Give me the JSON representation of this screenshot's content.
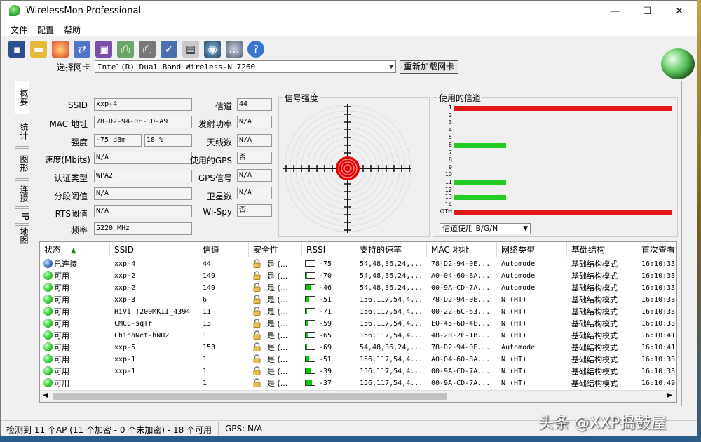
{
  "window": {
    "title": "WirelessMon Professional",
    "minimize": "—",
    "maximize": "☐",
    "close": "✕"
  },
  "menu": [
    "文件",
    "配置",
    "帮助"
  ],
  "toolbar_icons": [
    "save-icon",
    "open-folder-icon",
    "record-icon",
    "network-icon",
    "computers-icon",
    "print-icon",
    "printer-icon",
    "check-icon",
    "clipboard-icon",
    "globe-network-icon",
    "chat-icon",
    "help-icon"
  ],
  "adapter": {
    "label": "选择网卡",
    "value": "Intel(R) Dual Band Wireless-N 7260",
    "reload": "重新加载网卡"
  },
  "tabs": [
    "概要",
    "统计",
    "图形",
    "连接",
    "IP",
    "地图"
  ],
  "summary": {
    "ssid_label": "SSID",
    "ssid": "xxp-4",
    "mac_label": "MAC 地址",
    "mac": "78-D2-94-0E-1D-A9",
    "strength_label": "强度",
    "strength_dbm": "-75 dBm",
    "strength_pct": "18 %",
    "speed_label": "速度(Mbits)",
    "speed": "N/A",
    "auth_label": "认证类型",
    "auth": "WPA2",
    "frag_label": "分段阈值",
    "frag": "N/A",
    "rts_label": "RTS阈值",
    "rts": "N/A",
    "freq_label": "频率",
    "freq": "5220 MHz",
    "channel_label": "信道",
    "channel": "44",
    "txpower_label": "发射功率",
    "txpower": "N/A",
    "antenna_label": "天线数",
    "antenna": "N/A",
    "gps_used_label": "使用的GPS",
    "gps_used": "否",
    "gps_signal_label": "GPS信号",
    "gps_signal": "N/A",
    "satellites_label": "卫星数",
    "satellites": "N/A",
    "wispy_label": "Wi-Spy",
    "wispy": "否"
  },
  "signal_panel": {
    "title": "信号强度"
  },
  "channel_panel": {
    "title": "使用的信道",
    "select": "信道使用 B/G/N",
    "colors": {
      "high": "#e01818",
      "medium": "#22cc22"
    },
    "channels": [
      {
        "label": "1",
        "usage": 1.0,
        "level": "high"
      },
      {
        "label": "2",
        "usage": 0,
        "level": "none"
      },
      {
        "label": "3",
        "usage": 0,
        "level": "none"
      },
      {
        "label": "4",
        "usage": 0,
        "level": "none"
      },
      {
        "label": "5",
        "usage": 0,
        "level": "none"
      },
      {
        "label": "6",
        "usage": 0.24,
        "level": "medium"
      },
      {
        "label": "7",
        "usage": 0,
        "level": "none"
      },
      {
        "label": "8",
        "usage": 0,
        "level": "none"
      },
      {
        "label": "9",
        "usage": 0,
        "level": "none"
      },
      {
        "label": "10",
        "usage": 0,
        "level": "none"
      },
      {
        "label": "11",
        "usage": 0.24,
        "level": "medium"
      },
      {
        "label": "12",
        "usage": 0,
        "level": "none"
      },
      {
        "label": "13",
        "usage": 0.24,
        "level": "medium"
      },
      {
        "label": "14",
        "usage": 0,
        "level": "none"
      },
      {
        "label": "OTH",
        "usage": 1.0,
        "level": "high"
      }
    ]
  },
  "table": {
    "columns": [
      "状态",
      "SSID",
      "信道",
      "安全性",
      "RSSI",
      "支持的速率",
      "MAC 地址",
      "网络类型",
      "基础结构",
      "首次查看"
    ],
    "rows": [
      {
        "status": "已连接",
        "connected": true,
        "ssid": "xxp-4",
        "channel": "44",
        "security": "是 (...",
        "rssi": "-75",
        "rssi_level": 0.1,
        "rates": "54,48,36,24,...",
        "mac": "78-D2-94-0E...",
        "nettype": "Automode",
        "infra": "基础结构模式",
        "first": "16:10:33"
      },
      {
        "status": "可用",
        "connected": false,
        "ssid": "xxp-2",
        "channel": "149",
        "security": "是 (...",
        "rssi": "-70",
        "rssi_level": 0.15,
        "rates": "54,48,36,24,...",
        "mac": "A0-04-60-8A...",
        "nettype": "Automode",
        "infra": "基础结构模式",
        "first": "16:10:33"
      },
      {
        "status": "可用",
        "connected": false,
        "ssid": "xxp-2",
        "channel": "149",
        "security": "是 (...",
        "rssi": "-46",
        "rssi_level": 0.5,
        "rates": "54,48,36,24,...",
        "mac": "00-9A-CD-7A...",
        "nettype": "Automode",
        "infra": "基础结构模式",
        "first": "16:10:33"
      },
      {
        "status": "可用",
        "connected": false,
        "ssid": "xxp-3",
        "channel": "6",
        "security": "是 (...",
        "rssi": "-51",
        "rssi_level": 0.4,
        "rates": "156,117,54,4...",
        "mac": "78-D2-94-0E...",
        "nettype": "N (HT)",
        "infra": "基础结构模式",
        "first": "16:10:33"
      },
      {
        "status": "可用",
        "connected": false,
        "ssid": "HiVi T200MKII_4394",
        "channel": "11",
        "security": "是 (...",
        "rssi": "-71",
        "rssi_level": 0.15,
        "rates": "156,117,54,4...",
        "mac": "00-22-6C-63...",
        "nettype": "N (HT)",
        "infra": "基础结构模式",
        "first": "16:10:33"
      },
      {
        "status": "可用",
        "connected": false,
        "ssid": "CMCC-sqTr",
        "channel": "13",
        "security": "是 (...",
        "rssi": "-59",
        "rssi_level": 0.3,
        "rates": "156,117,54,4...",
        "mac": "E0-45-6D-4E...",
        "nettype": "N (HT)",
        "infra": "基础结构模式",
        "first": "16:10:33"
      },
      {
        "status": "可用",
        "connected": false,
        "ssid": "ChinaNet-hNU2",
        "channel": "1",
        "security": "是 (...",
        "rssi": "-65",
        "rssi_level": 0.2,
        "rates": "156,117,54,4...",
        "mac": "48-28-2F-1B...",
        "nettype": "N (HT)",
        "infra": "基础结构模式",
        "first": "16:10:41"
      },
      {
        "status": "可用",
        "connected": false,
        "ssid": "xxp-5",
        "channel": "153",
        "security": "是 (...",
        "rssi": "-69",
        "rssi_level": 0.15,
        "rates": "54,48,36,24,...",
        "mac": "78-D2-94-0E...",
        "nettype": "Automode",
        "infra": "基础结构模式",
        "first": "16:10:41"
      },
      {
        "status": "可用",
        "connected": false,
        "ssid": "xxp-1",
        "channel": "1",
        "security": "是 (...",
        "rssi": "-51",
        "rssi_level": 0.4,
        "rates": "156,117,54,4...",
        "mac": "A0-04-60-8A...",
        "nettype": "N (HT)",
        "infra": "基础结构模式",
        "first": "16:10:33"
      },
      {
        "status": "可用",
        "connected": false,
        "ssid": "xxp-1",
        "channel": "1",
        "security": "是 (...",
        "rssi": "-39",
        "rssi_level": 0.65,
        "rates": "156,117,54,4...",
        "mac": "00-9A-CD-7A...",
        "nettype": "N (HT)",
        "infra": "基础结构模式",
        "first": "16:10:33"
      },
      {
        "status": "可用",
        "connected": false,
        "ssid": "",
        "channel": "1",
        "security": "是 (...",
        "rssi": "-37",
        "rssi_level": 0.7,
        "rates": "156,117,54,4...",
        "mac": "00-9A-CD-7A...",
        "nettype": "N (HT)",
        "infra": "基础结构模式",
        "first": "16:10:49"
      }
    ]
  },
  "status": {
    "summary": "检测到 11 个AP (11 个加密 - 0 个未加密) - 18 个可用",
    "gps": "GPS: N/A"
  },
  "watermark": "头条 @XXP捣鼓屋"
}
